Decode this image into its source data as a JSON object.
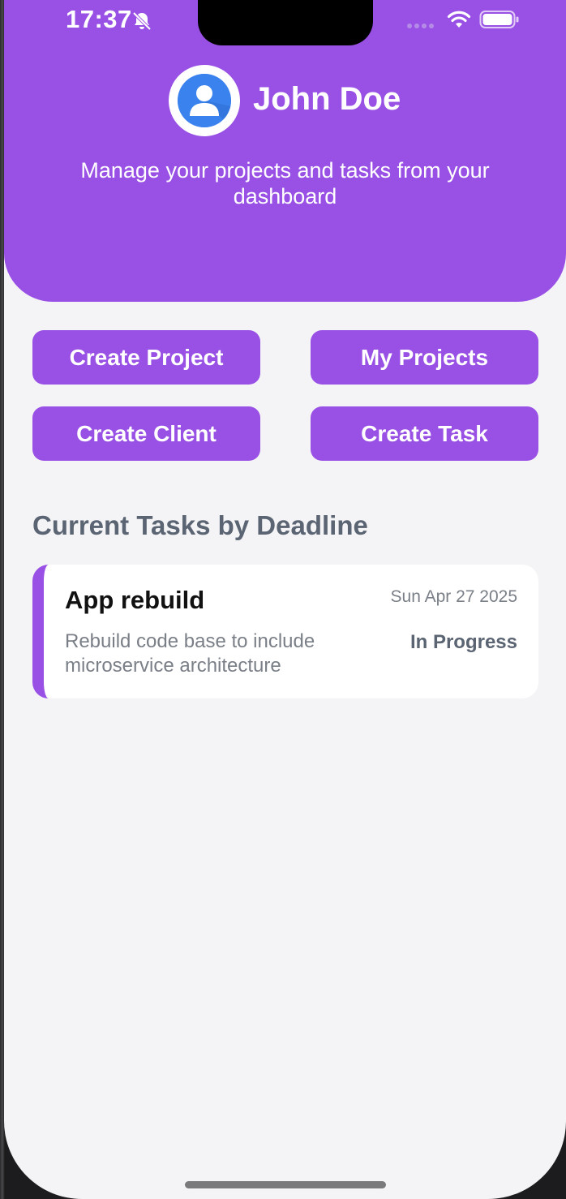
{
  "status_bar": {
    "time": "17:37"
  },
  "profile": {
    "name": "John Doe",
    "subtitle": "Manage your projects and tasks from your dashboard"
  },
  "actions": {
    "create_project": "Create Project",
    "my_projects": "My Projects",
    "create_client": "Create Client",
    "create_task": "Create Task"
  },
  "tasks_section": {
    "title": "Current Tasks by Deadline",
    "tasks": [
      {
        "title": "App rebuild",
        "date": "Sun Apr 27 2025",
        "description": "Rebuild code base to include microservice architecture",
        "status": "In Progress"
      }
    ]
  },
  "colors": {
    "accent": "#9950e5",
    "background": "#f4f4f6",
    "section_title": "#5a6472",
    "muted_text": "#7a7f87"
  },
  "icons": {
    "bell": "bell-slash-icon",
    "wifi": "wifi-icon",
    "battery": "battery-icon",
    "avatar": "user-avatar-icon"
  }
}
